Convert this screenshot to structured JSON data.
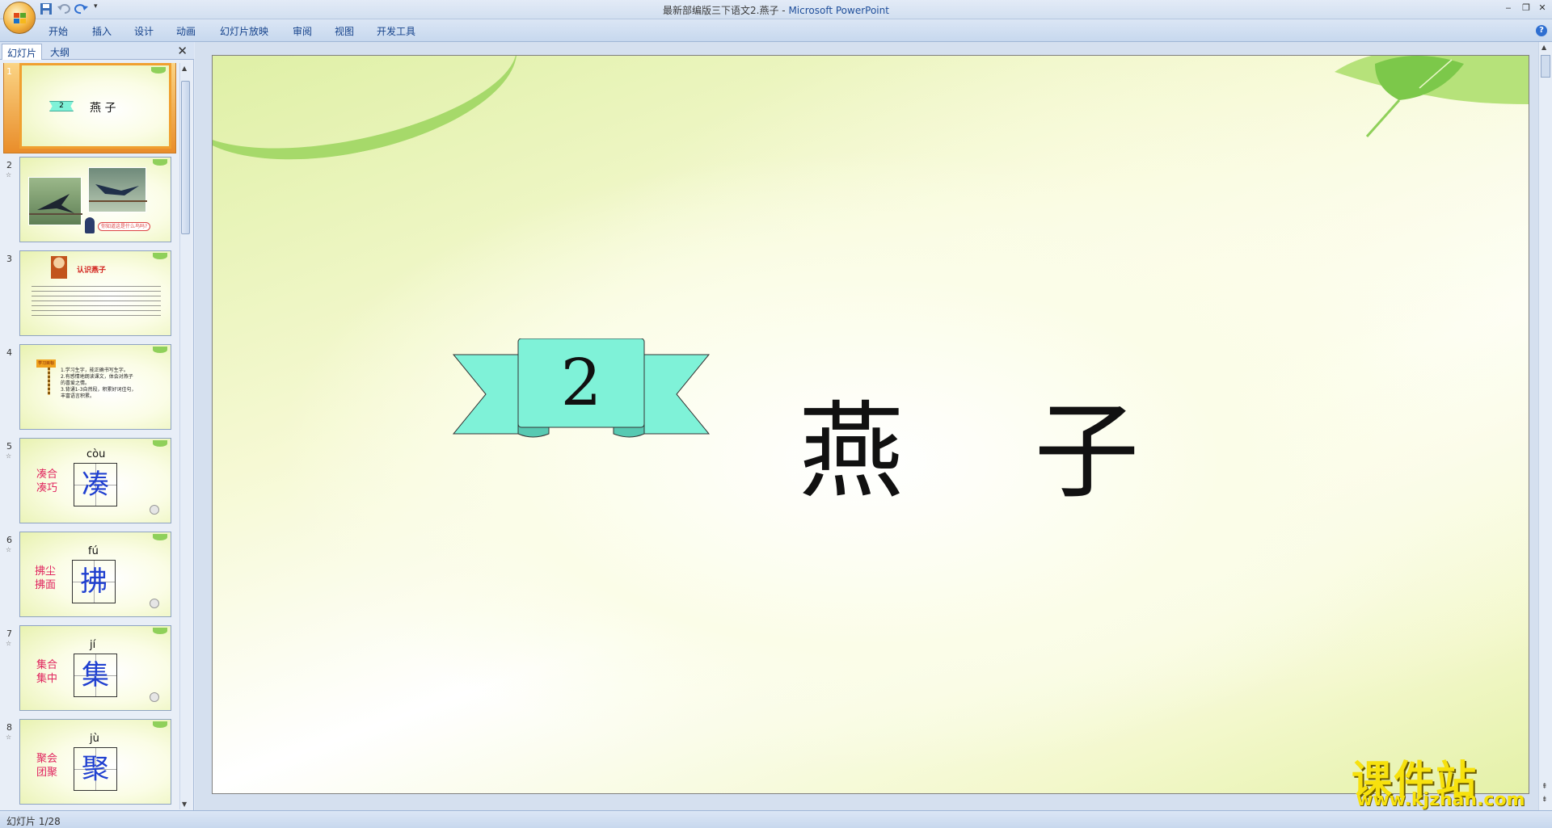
{
  "window": {
    "document_title": "最新部编版三下语文2.燕子",
    "separator": " - ",
    "app_name": "Microsoft PowerPoint"
  },
  "ribbon": {
    "tabs": [
      "开始",
      "插入",
      "设计",
      "动画",
      "幻灯片放映",
      "审阅",
      "视图",
      "开发工具"
    ]
  },
  "left_pane": {
    "tabs": [
      "幻灯片",
      "大纲"
    ],
    "thumbnails": [
      {
        "num": "1",
        "number_badge": "2",
        "title": "燕 子"
      },
      {
        "num": "2",
        "caption": "你知道这是什么鸟吗?"
      },
      {
        "num": "3",
        "heading": "认识燕子"
      },
      {
        "num": "4",
        "badge": "学习目标",
        "lines": [
          "1.学习生字，能正确书写生字。",
          "2.有感情地朗读课文，体会对燕子",
          "的喜爱之情。",
          "3.背诵1-3自然段，积累好词佳句，",
          "丰富语言积累。"
        ]
      },
      {
        "num": "5",
        "pinyin": "còu",
        "char": "凑",
        "words": [
          "凑合",
          "凑巧"
        ]
      },
      {
        "num": "6",
        "pinyin": "fú",
        "char": "拂",
        "words": [
          "拂尘",
          "拂面"
        ]
      },
      {
        "num": "7",
        "pinyin": "jí",
        "char": "集",
        "words": [
          "集合",
          "集中"
        ]
      },
      {
        "num": "8",
        "pinyin": "jù",
        "char": "聚",
        "words": [
          "聚会",
          "团聚"
        ]
      }
    ]
  },
  "slide": {
    "number_badge": "2",
    "title": "燕 子"
  },
  "watermark": {
    "text": "课件站",
    "url": "www.kjzhan.com"
  },
  "status": {
    "slide_counter": "幻灯片 1/28"
  },
  "colors": {
    "ribbon_fill": "#7ff2d8",
    "accent_red": "#e0245e",
    "char_blue": "#2040d0",
    "watermark_yellow": "#f7e10d"
  }
}
